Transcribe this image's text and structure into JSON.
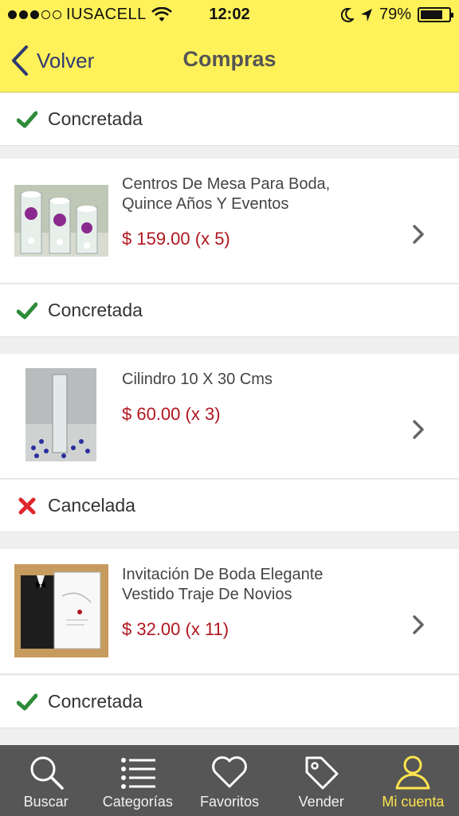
{
  "status_bar": {
    "carrier": "IUSACELL",
    "time": "12:02",
    "battery": "79%",
    "battery_level": 0.79
  },
  "nav": {
    "back_label": "Volver",
    "title": "Compras"
  },
  "orders": [
    {
      "status": "Concretada"
    },
    {
      "title_line1": "Centros De Mesa Para Boda,",
      "title_line2": "Quince Años Y Eventos",
      "price": "$ 159.00 (x 5)",
      "status": "Concretada"
    },
    {
      "title_line1": "Cilindro 10 X 30 Cms",
      "title_line2": "",
      "price": "$ 60.00 (x 3)",
      "status": "Cancelada"
    },
    {
      "title_line1": "Invitación De Boda Elegante",
      "title_line2": "Vestido Traje De Novios",
      "price": "$ 32.00 (x 11)",
      "status": "Concretada"
    }
  ],
  "tabs": [
    {
      "label": "Buscar",
      "icon": "search-icon"
    },
    {
      "label": "Categorías",
      "icon": "list-icon"
    },
    {
      "label": "Favoritos",
      "icon": "heart-icon"
    },
    {
      "label": "Vender",
      "icon": "tag-icon"
    },
    {
      "label": "Mi cuenta",
      "icon": "user-icon",
      "active": true
    }
  ],
  "colors": {
    "header": "#fff159",
    "price": "#b0161e",
    "success": "#2e8b3a",
    "cancel": "#e0262d",
    "tabbar": "#565656",
    "tab_active": "#ffe44d"
  }
}
